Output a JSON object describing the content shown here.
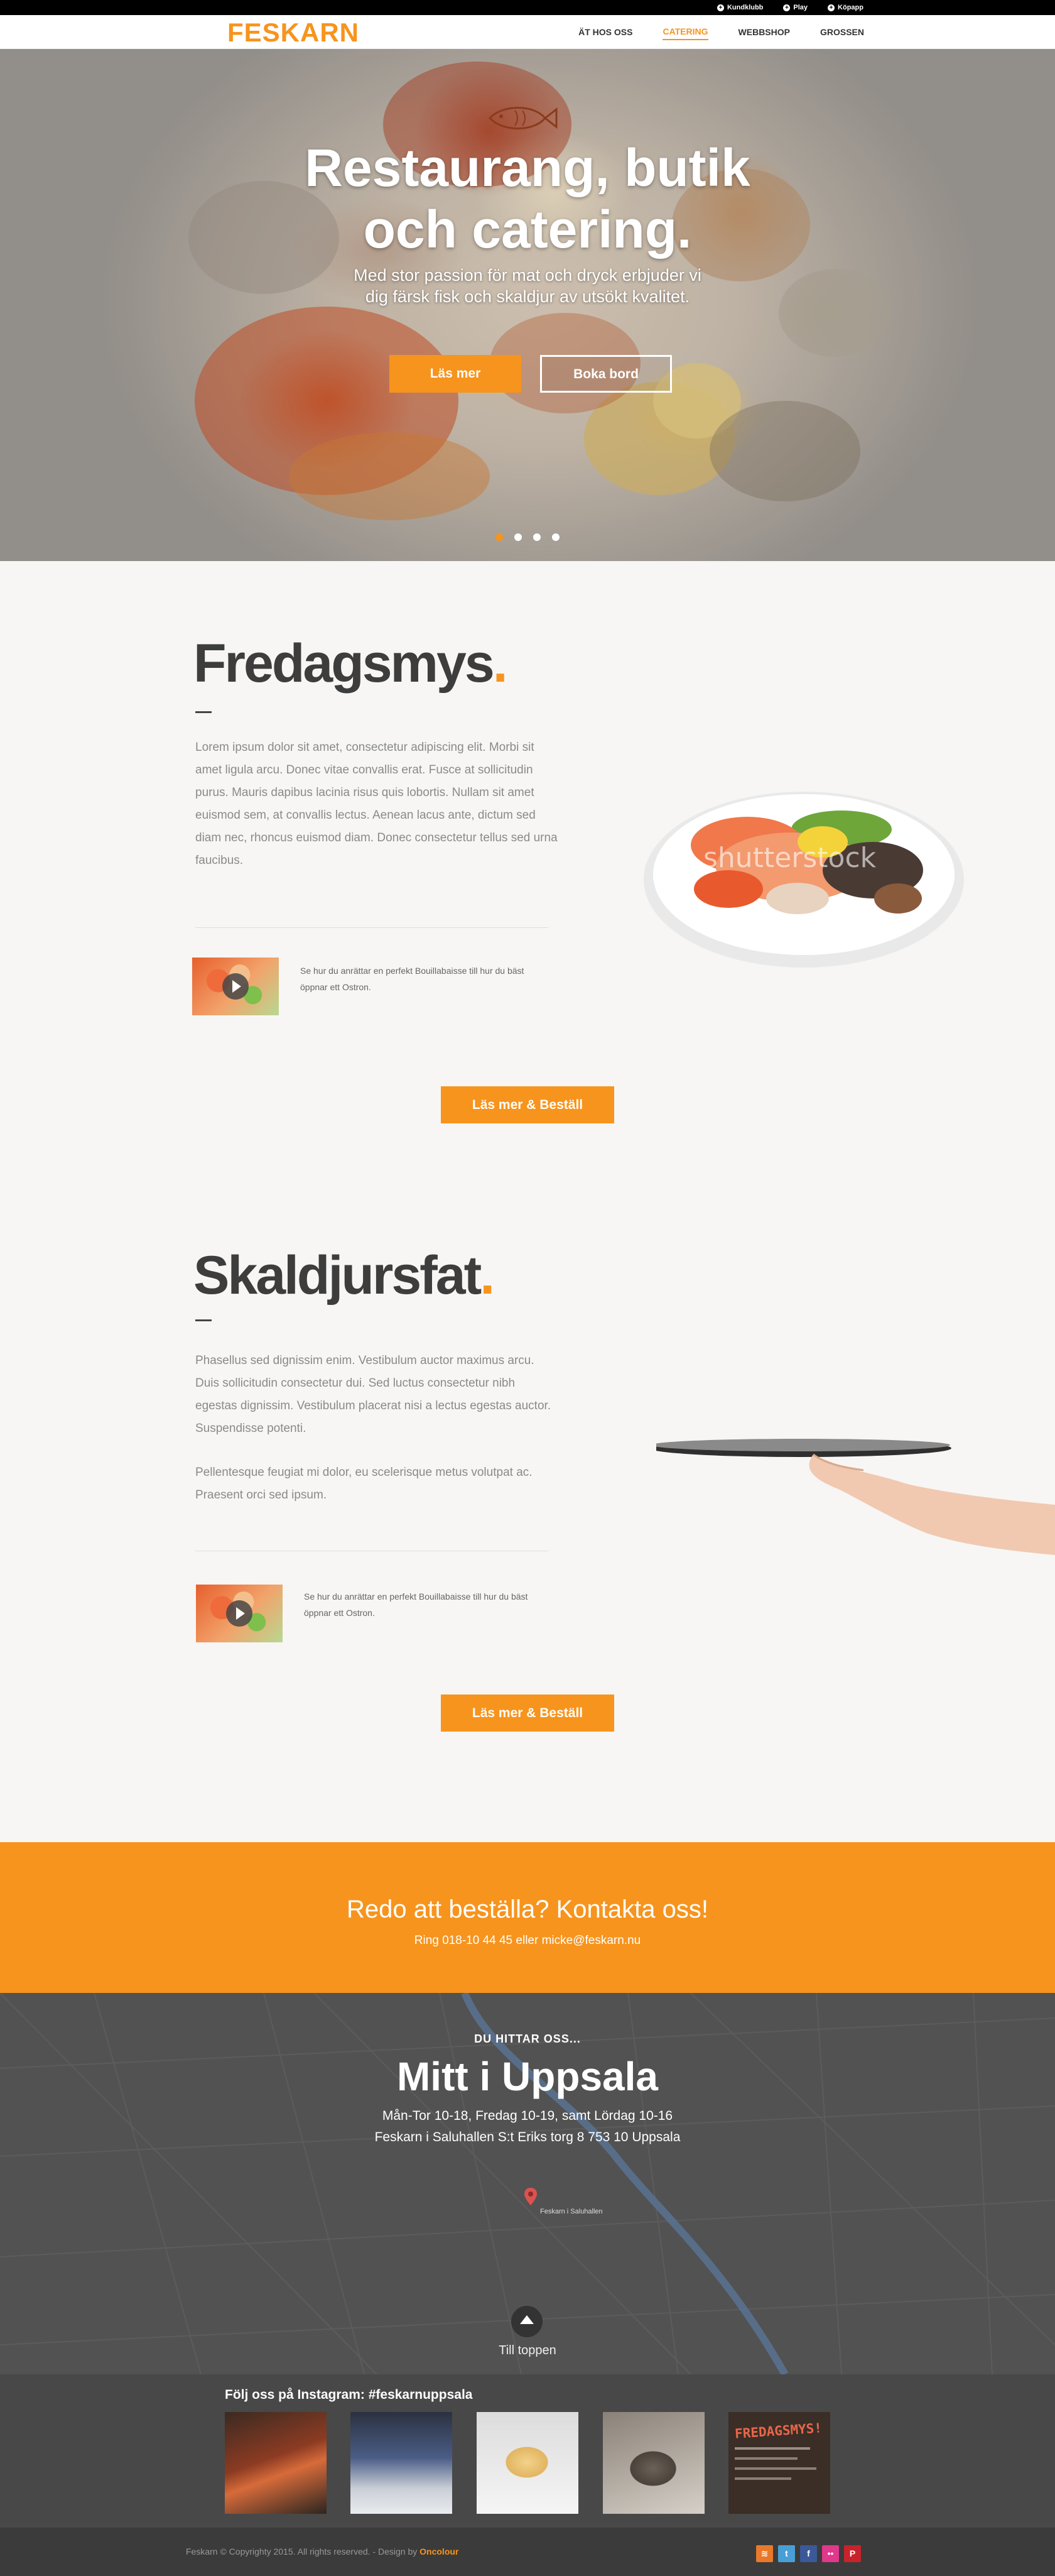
{
  "topbar": {
    "links": [
      "Kundklubb",
      "Play",
      "Köpapp"
    ]
  },
  "header": {
    "logo": "FESKARN",
    "nav": [
      "ÄT HOS OSS",
      "CATERING",
      "WEBBSHOP",
      "GROSSEN"
    ],
    "active_nav": "CATERING"
  },
  "hero": {
    "title_line1": "Restaurang, butik",
    "title_line2": "och catering.",
    "subtitle": "Med stor passion för mat och dryck erbjuder vi dig färsk fisk och skaldjur av utsökt kvalitet.",
    "btn_primary": "Läs mer",
    "btn_secondary": "Boka bord",
    "slides": 4,
    "active_slide": 1
  },
  "section1": {
    "title": "Fredagsmys",
    "title_dot": ".",
    "text": "Lorem ipsum dolor sit amet, consectetur adipiscing elit. Morbi sit amet ligula arcu. Donec vitae convallis erat. Fusce at sollicitudin purus. Mauris dapibus lacinia risus quis lobortis. Nullam sit amet euismod sem, at convallis lectus. Aenean lacus ante, dictum sed diam nec, rhoncus euismod diam. Donec consectetur tellus sed urna faucibus.",
    "video_caption": "Se hur du anrättar en perfekt Bouillabaisse till hur du bäst öppnar ett Ostron.",
    "cta": "Läs mer & Beställ",
    "image_watermark": "shutterstock"
  },
  "section2": {
    "title": "Skaldjursfat",
    "title_dot": ".",
    "text_p1": "Phasellus sed dignissim enim. Vestibulum auctor maximus arcu. Duis sollicitudin consectetur dui. Sed luctus consectetur nibh egestas dignissim. Vestibulum placerat nisi a lectus egestas auctor. Suspendisse potenti.",
    "text_p2": "Pellentesque feugiat mi dolor, eu scelerisque metus volutpat ac. Praesent orci sed ipsum.",
    "video_caption": "Se hur du anrättar en perfekt Bouillabaisse till hur du bäst öppnar ett Ostron.",
    "cta": "Läs mer & Beställ"
  },
  "contact_band": {
    "title": "Redo att beställa?",
    "link": "Kontakta oss!",
    "sub": "Ring 018-10 44 45 eller micke@feskarn.nu"
  },
  "map": {
    "kicker": "DU HITTAR OSS...",
    "title": "Mitt i Uppsala",
    "hours": "Mån-Tor 10-18,  Fredag 10-19,  samt Lördag 10-16",
    "address": "Feskarn i Saluhallen    S:t Eriks torg 8    753 10 Uppsala",
    "pin_label": "Feskarn i Saluhallen",
    "to_top": "Till toppen"
  },
  "instagram": {
    "title": "Följ oss på Instagram: #feskarnuppsala",
    "sign_text": "FREDAGSMYS!"
  },
  "footer": {
    "copyright": "Feskarn © Copyrighty 2015. All rights reserved. - Design by ",
    "designer": "Oncolour",
    "social_glyphs": [
      "rss",
      "twitter",
      "facebook",
      "flickr",
      "pinterest"
    ],
    "social_labels": [
      "≋",
      "t",
      "f",
      "••",
      "P"
    ]
  },
  "colors": {
    "accent": "#f7941d",
    "dark": "#3d3d3d",
    "footer": "#3b3b3b",
    "instagram_bg": "#484848"
  }
}
